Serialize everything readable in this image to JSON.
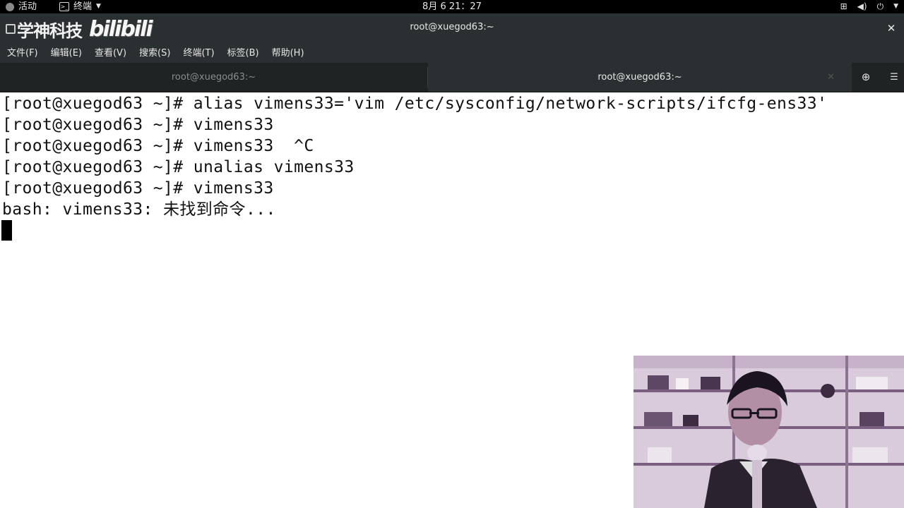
{
  "topbar": {
    "activities": "活动",
    "app_name": "终端",
    "clock": "8月 6  21：27"
  },
  "window": {
    "title": "root@xuegod63:~",
    "watermark_text": "学神科技",
    "watermark_logo": "bilibili"
  },
  "menu": {
    "items": [
      "文件(F)",
      "编辑(E)",
      "查看(V)",
      "搜索(S)",
      "终端(T)",
      "标签(B)",
      "帮助(H)"
    ]
  },
  "tabs": [
    {
      "label": "root@xuegod63:~",
      "active": false
    },
    {
      "label": "root@xuegod63:~",
      "active": true
    }
  ],
  "terminal": {
    "lines": [
      "[root@xuegod63 ~]# alias vimens33='vim /etc/sysconfig/network-scripts/ifcfg-ens33'",
      "[root@xuegod63 ~]# vimens33",
      "[root@xuegod63 ~]# vimens33  ^C",
      "[root@xuegod63 ~]# unalias vimens33",
      "[root@xuegod63 ~]# vimens33",
      "bash: vimens33: 未找到命令..."
    ]
  }
}
